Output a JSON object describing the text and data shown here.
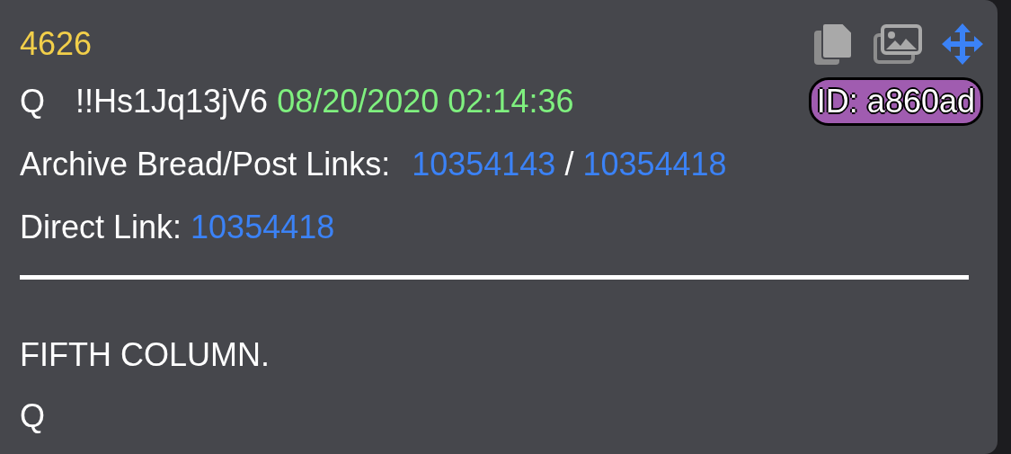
{
  "post": {
    "number": "4626",
    "author": "Q",
    "tripcode": "!!Hs1Jq13jV6",
    "timestamp": "08/20/2020 02:14:36",
    "id_badge": "ID: a860ad",
    "archive_label": "Archive Bread/Post Links:",
    "archive_links": [
      "10354143",
      "10354418"
    ],
    "archive_separator": "/",
    "direct_label": "Direct Link:",
    "direct_link": "10354418",
    "body": [
      "FIFTH COLUMN.",
      "Q"
    ]
  }
}
